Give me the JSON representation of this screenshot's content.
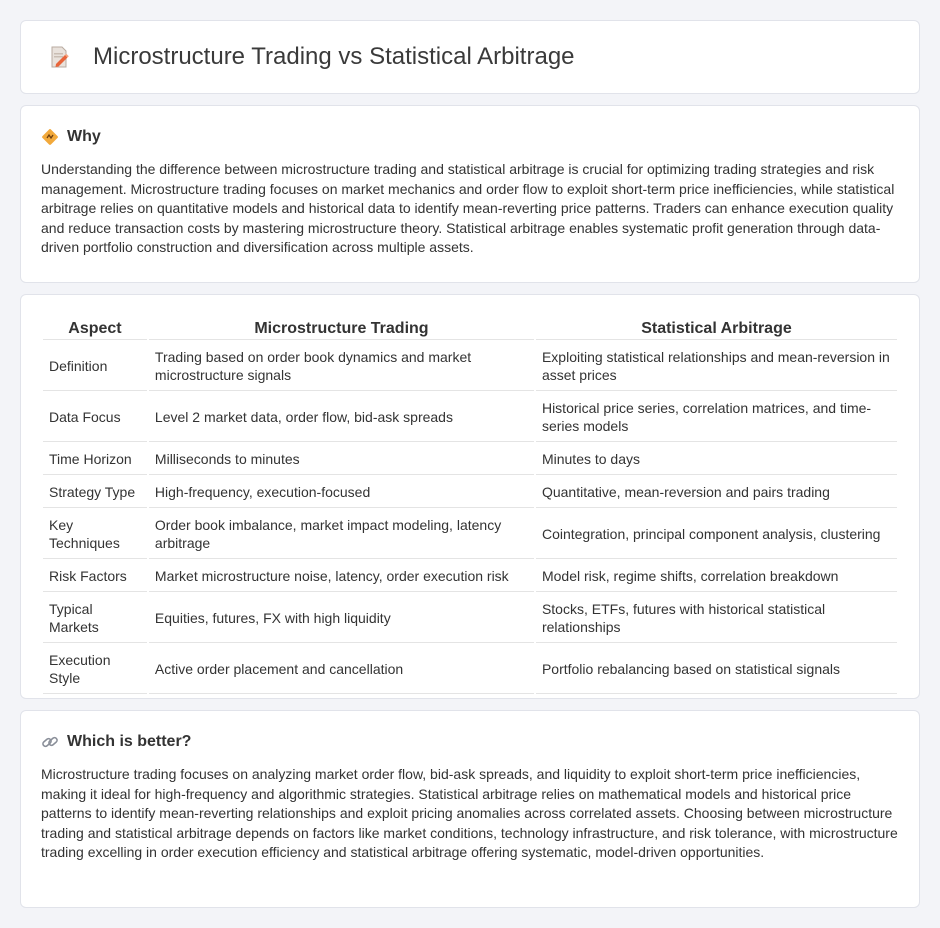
{
  "header": {
    "title": "Microstructure Trading vs Statistical Arbitrage",
    "icon": "document-pencil-icon"
  },
  "why": {
    "title": "Why",
    "icon": "diamond-sign-icon",
    "text": "Understanding the difference between microstructure trading and statistical arbitrage is crucial for optimizing trading strategies and risk management. Microstructure trading focuses on market mechanics and order flow to exploit short-term price inefficiencies, while statistical arbitrage relies on quantitative models and historical data to identify mean-reverting price patterns. Traders can enhance execution quality and reduce transaction costs by mastering microstructure theory. Statistical arbitrage enables systematic profit generation through data-driven portfolio construction and diversification across multiple assets."
  },
  "table": {
    "headers": [
      "Aspect",
      "Microstructure Trading",
      "Statistical Arbitrage"
    ],
    "rows": [
      [
        "Definition",
        "Trading based on order book dynamics and market microstructure signals",
        "Exploiting statistical relationships and mean-reversion in asset prices"
      ],
      [
        "Data Focus",
        "Level 2 market data, order flow, bid-ask spreads",
        "Historical price series, correlation matrices, and time-series models"
      ],
      [
        "Time Horizon",
        "Milliseconds to minutes",
        "Minutes to days"
      ],
      [
        "Strategy Type",
        "High-frequency, execution-focused",
        "Quantitative, mean-reversion and pairs trading"
      ],
      [
        "Key Techniques",
        "Order book imbalance, market impact modeling, latency arbitrage",
        "Cointegration, principal component analysis, clustering"
      ],
      [
        "Risk Factors",
        "Market microstructure noise, latency, order execution risk",
        "Model risk, regime shifts, correlation breakdown"
      ],
      [
        "Typical Markets",
        "Equities, futures, FX with high liquidity",
        "Stocks, ETFs, futures with historical statistical relationships"
      ],
      [
        "Execution Style",
        "Active order placement and cancellation",
        "Portfolio rebalancing based on statistical signals"
      ]
    ]
  },
  "better": {
    "title": "Which is better?",
    "icon": "link-icon",
    "text": "Microstructure trading focuses on analyzing market order flow, bid-ask spreads, and liquidity to exploit short-term price inefficiencies, making it ideal for high-frequency and algorithmic strategies. Statistical arbitrage relies on mathematical models and historical price patterns to identify mean-reverting relationships and exploit pricing anomalies across correlated assets. Choosing between microstructure trading and statistical arbitrage depends on factors like market conditions, technology infrastructure, and risk tolerance, with microstructure trading excelling in order execution efficiency and statistical arbitrage offering systematic, model-driven opportunities."
  }
}
